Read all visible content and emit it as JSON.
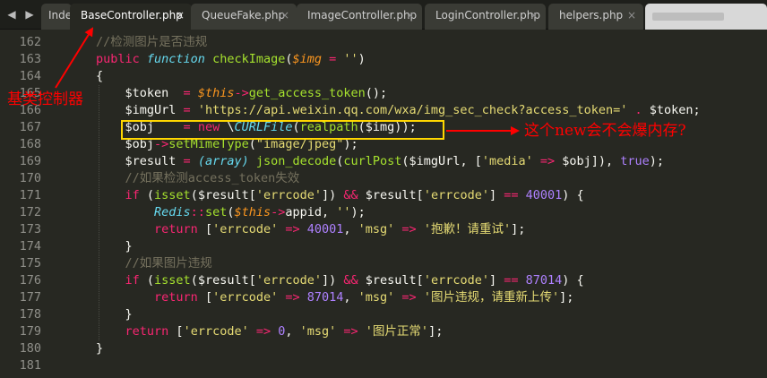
{
  "tabs": [
    {
      "label": "Index",
      "active": false
    },
    {
      "label": "BaseController.php",
      "active": true
    },
    {
      "label": "QueueFake.php",
      "active": false
    },
    {
      "label": "ImageController.php",
      "active": false
    },
    {
      "label": "LoginController.php",
      "active": false
    },
    {
      "label": "helpers.php",
      "active": false
    }
  ],
  "tab_close_glyph": "×",
  "nav": {
    "left": "◀",
    "right": "▶"
  },
  "editor": {
    "line_numbers": [
      "162",
      "163",
      "164",
      "165",
      "166",
      "167",
      "168",
      "169",
      "170",
      "171",
      "172",
      "173",
      "174",
      "175",
      "176",
      "177",
      "178",
      "179",
      "180",
      "181"
    ],
    "lines": [
      [
        {
          "t": "//检测图片是否违规",
          "c": "c"
        }
      ],
      [
        {
          "t": "public ",
          "c": "k"
        },
        {
          "t": "function ",
          "c": "st"
        },
        {
          "t": "checkImage",
          "c": "fn"
        },
        {
          "t": "(",
          "c": "p"
        },
        {
          "t": "$img",
          "c": "v"
        },
        {
          "t": " = ",
          "c": "k"
        },
        {
          "t": "''",
          "c": "s"
        },
        {
          "t": ")",
          "c": "p"
        }
      ],
      [
        {
          "t": "{",
          "c": "p"
        }
      ],
      [
        {
          "t": "    $token  ",
          "c": "p"
        },
        {
          "t": "= ",
          "c": "k"
        },
        {
          "t": "$this",
          "c": "v"
        },
        {
          "t": "->",
          "c": "k"
        },
        {
          "t": "get_access_token",
          "c": "fn"
        },
        {
          "t": "();",
          "c": "p"
        }
      ],
      [
        {
          "t": "    $imgUrl ",
          "c": "p"
        },
        {
          "t": "= ",
          "c": "k"
        },
        {
          "t": "'https://api.weixin.qq.com/wxa/img_sec_check?access_token='",
          "c": "s"
        },
        {
          "t": " . ",
          "c": "k"
        },
        {
          "t": "$token;",
          "c": "p"
        }
      ],
      [
        {
          "t": "    $obj    ",
          "c": "p"
        },
        {
          "t": "= ",
          "c": "k"
        },
        {
          "t": "new ",
          "c": "k"
        },
        {
          "t": "\\",
          "c": "p"
        },
        {
          "t": "CURLFile",
          "c": "cls"
        },
        {
          "t": "(",
          "c": "p"
        },
        {
          "t": "realpath",
          "c": "fn"
        },
        {
          "t": "($img));",
          "c": "p"
        }
      ],
      [
        {
          "t": "    $obj",
          "c": "p"
        },
        {
          "t": "->",
          "c": "k"
        },
        {
          "t": "setMimeType",
          "c": "fn"
        },
        {
          "t": "(",
          "c": "p"
        },
        {
          "t": "\"image/jpeg\"",
          "c": "s"
        },
        {
          "t": ");",
          "c": "p"
        }
      ],
      [
        {
          "t": "    $result ",
          "c": "p"
        },
        {
          "t": "= ",
          "c": "k"
        },
        {
          "t": "(array) ",
          "c": "st"
        },
        {
          "t": "json_decode",
          "c": "fn"
        },
        {
          "t": "(",
          "c": "p"
        },
        {
          "t": "curlPost",
          "c": "fn"
        },
        {
          "t": "($imgUrl, [",
          "c": "p"
        },
        {
          "t": "'media'",
          "c": "s"
        },
        {
          "t": " => ",
          "c": "k"
        },
        {
          "t": "$obj]), ",
          "c": "p"
        },
        {
          "t": "true",
          "c": "n"
        },
        {
          "t": ");",
          "c": "p"
        }
      ],
      [
        {
          "t": "    //如果检测access_token失效",
          "c": "c"
        }
      ],
      [
        {
          "t": "    ",
          "c": "p"
        },
        {
          "t": "if ",
          "c": "k"
        },
        {
          "t": "(",
          "c": "p"
        },
        {
          "t": "isset",
          "c": "fn"
        },
        {
          "t": "($result[",
          "c": "p"
        },
        {
          "t": "'errcode'",
          "c": "s"
        },
        {
          "t": "]) ",
          "c": "p"
        },
        {
          "t": "&& ",
          "c": "k"
        },
        {
          "t": "$result[",
          "c": "p"
        },
        {
          "t": "'errcode'",
          "c": "s"
        },
        {
          "t": "] ",
          "c": "p"
        },
        {
          "t": "== ",
          "c": "k"
        },
        {
          "t": "40001",
          "c": "n"
        },
        {
          "t": ") {",
          "c": "p"
        }
      ],
      [
        {
          "t": "        ",
          "c": "p"
        },
        {
          "t": "Redis",
          "c": "cls"
        },
        {
          "t": "::",
          "c": "k"
        },
        {
          "t": "set",
          "c": "fn"
        },
        {
          "t": "(",
          "c": "p"
        },
        {
          "t": "$this",
          "c": "v"
        },
        {
          "t": "->",
          "c": "k"
        },
        {
          "t": "appid, ",
          "c": "p"
        },
        {
          "t": "''",
          "c": "s"
        },
        {
          "t": ");",
          "c": "p"
        }
      ],
      [
        {
          "t": "        ",
          "c": "p"
        },
        {
          "t": "return ",
          "c": "k"
        },
        {
          "t": "[",
          "c": "p"
        },
        {
          "t": "'errcode'",
          "c": "s"
        },
        {
          "t": " => ",
          "c": "k"
        },
        {
          "t": "40001",
          "c": "n"
        },
        {
          "t": ", ",
          "c": "p"
        },
        {
          "t": "'msg'",
          "c": "s"
        },
        {
          "t": " => ",
          "c": "k"
        },
        {
          "t": "'抱歉！请重试'",
          "c": "s"
        },
        {
          "t": "];",
          "c": "p"
        }
      ],
      [
        {
          "t": "    }",
          "c": "p"
        }
      ],
      [
        {
          "t": "    //如果图片违规",
          "c": "c"
        }
      ],
      [
        {
          "t": "    ",
          "c": "p"
        },
        {
          "t": "if ",
          "c": "k"
        },
        {
          "t": "(",
          "c": "p"
        },
        {
          "t": "isset",
          "c": "fn"
        },
        {
          "t": "($result[",
          "c": "p"
        },
        {
          "t": "'errcode'",
          "c": "s"
        },
        {
          "t": "]) ",
          "c": "p"
        },
        {
          "t": "&& ",
          "c": "k"
        },
        {
          "t": "$result[",
          "c": "p"
        },
        {
          "t": "'errcode'",
          "c": "s"
        },
        {
          "t": "] ",
          "c": "p"
        },
        {
          "t": "== ",
          "c": "k"
        },
        {
          "t": "87014",
          "c": "n"
        },
        {
          "t": ") {",
          "c": "p"
        }
      ],
      [
        {
          "t": "        ",
          "c": "p"
        },
        {
          "t": "return ",
          "c": "k"
        },
        {
          "t": "[",
          "c": "p"
        },
        {
          "t": "'errcode'",
          "c": "s"
        },
        {
          "t": " => ",
          "c": "k"
        },
        {
          "t": "87014",
          "c": "n"
        },
        {
          "t": ", ",
          "c": "p"
        },
        {
          "t": "'msg'",
          "c": "s"
        },
        {
          "t": " => ",
          "c": "k"
        },
        {
          "t": "'图片违规，请重新上传'",
          "c": "s"
        },
        {
          "t": "];",
          "c": "p"
        }
      ],
      [
        {
          "t": "    }",
          "c": "p"
        }
      ],
      [
        {
          "t": "    ",
          "c": "p"
        },
        {
          "t": "return ",
          "c": "k"
        },
        {
          "t": "[",
          "c": "p"
        },
        {
          "t": "'errcode'",
          "c": "s"
        },
        {
          "t": " => ",
          "c": "k"
        },
        {
          "t": "0",
          "c": "n"
        },
        {
          "t": ", ",
          "c": "p"
        },
        {
          "t": "'msg'",
          "c": "s"
        },
        {
          "t": " => ",
          "c": "k"
        },
        {
          "t": "'图片正常'",
          "c": "s"
        },
        {
          "t": "];",
          "c": "p"
        }
      ],
      [
        {
          "t": "}",
          "c": "p"
        }
      ],
      []
    ]
  },
  "annotations": {
    "base_controller_label": "基类控制器",
    "new_question_label": "这个new会不会爆内存?"
  },
  "colors": {
    "annotation_red": "#ff0000",
    "highlight_box": "#ffd700",
    "editor_bg": "#272822"
  }
}
